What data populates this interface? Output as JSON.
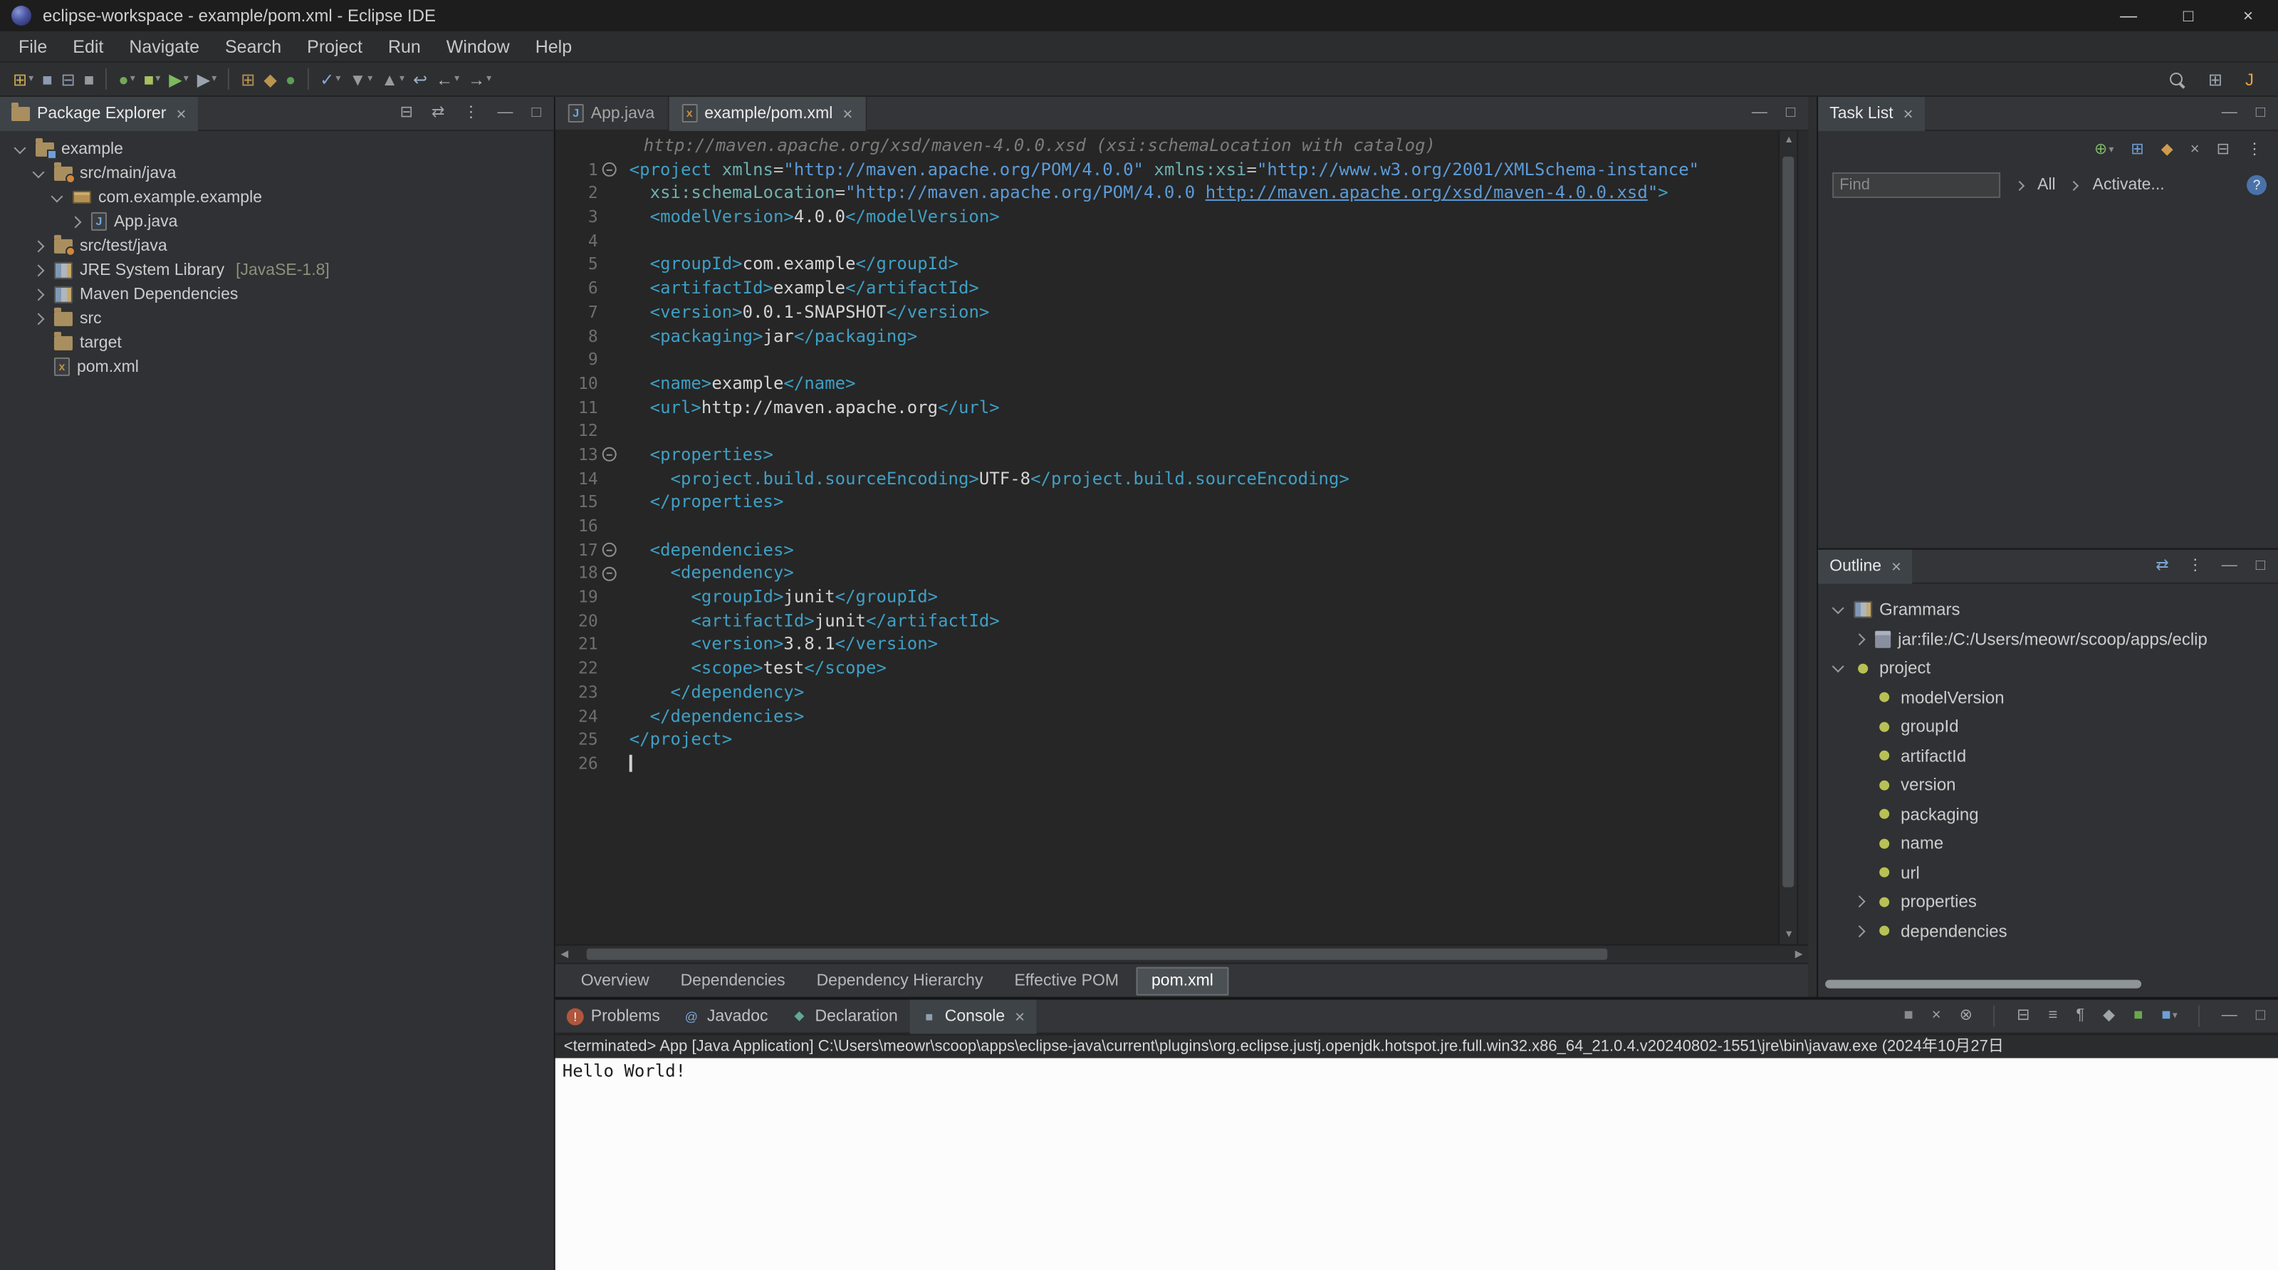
{
  "glyphs": {
    "close": "×",
    "dropdown": "▾",
    "minimize": "—",
    "maximize": "□",
    "up": "▲",
    "down": "▼",
    "left": "◀",
    "right": "▶"
  },
  "window": {
    "title": "eclipse-workspace - example/pom.xml - Eclipse IDE",
    "controls": [
      {
        "name": "minimize",
        "glyph": "—"
      },
      {
        "name": "maximize",
        "glyph": "□"
      },
      {
        "name": "close",
        "glyph": "×"
      }
    ]
  },
  "menu": {
    "items": [
      "File",
      "Edit",
      "Navigate",
      "Search",
      "Project",
      "Run",
      "Window",
      "Help"
    ]
  },
  "toolbar": {
    "items": [
      {
        "name": "new-wizard",
        "glyph": "⊞",
        "color": "#c9a952",
        "drop": true
      },
      {
        "name": "save",
        "glyph": "■",
        "color": "#8c9bb0"
      },
      {
        "name": "save-all",
        "glyph": "⊟",
        "color": "#8c9bb0"
      },
      {
        "name": "print",
        "glyph": "■",
        "color": "#97999c"
      },
      {
        "sep": true
      },
      {
        "name": "debug",
        "glyph": "●",
        "color": "#74a85c",
        "drop": true
      },
      {
        "name": "coverage",
        "glyph": "■",
        "color": "#a8c060",
        "drop": true
      },
      {
        "name": "run",
        "glyph": "▶",
        "color": "#7cba5d",
        "drop": true
      },
      {
        "name": "external-tools",
        "glyph": "▶",
        "color": "#9aa3ad",
        "drop": true
      },
      {
        "sep": true
      },
      {
        "name": "new-java-project",
        "glyph": "⊞",
        "color": "#b89454"
      },
      {
        "name": "new-package",
        "glyph": "◆",
        "color": "#ba9550"
      },
      {
        "name": "new-class",
        "glyph": "●",
        "color": "#5d9e55"
      },
      {
        "sep": true
      },
      {
        "name": "open-task",
        "glyph": "✓",
        "color": "#86a6d8",
        "drop": true
      },
      {
        "name": "next-annotation",
        "glyph": "▼",
        "color": "#9a9a9a",
        "drop": true
      },
      {
        "name": "previous-annotation",
        "glyph": "▲",
        "color": "#9a9a9a",
        "drop": true
      },
      {
        "name": "last-edit-location",
        "glyph": "↩",
        "color": "#9ab0c8"
      },
      {
        "name": "back",
        "glyph": "←",
        "color": "#b8b8b8",
        "drop": true
      },
      {
        "name": "forward",
        "glyph": "→",
        "color": "#b8b8b8",
        "drop": true
      }
    ],
    "right": [
      {
        "name": "search",
        "shape": "magnifier"
      },
      {
        "name": "open-perspective",
        "glyph": "⊞",
        "color": "#9aa3ad"
      },
      {
        "name": "java-perspective",
        "glyph": "J",
        "color": "#e2a33f"
      }
    ]
  },
  "package_explorer": {
    "title": "Package Explorer",
    "header_icons": [
      {
        "name": "collapse-all",
        "glyph": "⊟",
        "color": "#9fa4a8"
      },
      {
        "name": "link-with-editor",
        "glyph": "⇄",
        "color": "#9fa4a8"
      },
      {
        "name": "view-menu",
        "glyph": "⋮",
        "color": "#b8b8b8"
      },
      {
        "name": "minimize",
        "glyph": "—",
        "color": "#9fa4a8"
      },
      {
        "name": "maximize",
        "glyph": "□",
        "color": "#9fa4a8"
      }
    ],
    "tree": [
      {
        "depth": 0,
        "expander": "down",
        "icon": "project",
        "label": "example"
      },
      {
        "depth": 1,
        "expander": "down",
        "icon": "src",
        "label": "src/main/java"
      },
      {
        "depth": 2,
        "expander": "down",
        "icon": "package",
        "label": "com.example.example"
      },
      {
        "depth": 3,
        "expander": "right",
        "icon": "javafile",
        "label": "App.java"
      },
      {
        "depth": 1,
        "expander": "right",
        "icon": "src",
        "label": "src/test/java"
      },
      {
        "depth": 1,
        "expander": "right",
        "icon": "library",
        "label": "JRE System Library",
        "suffix": "[JavaSE-1.8]"
      },
      {
        "depth": 1,
        "expander": "right",
        "icon": "library",
        "label": "Maven Dependencies"
      },
      {
        "depth": 1,
        "expander": "right",
        "icon": "folder",
        "label": "src"
      },
      {
        "depth": 1,
        "expander": "none",
        "icon": "folder",
        "label": "target"
      },
      {
        "depth": 1,
        "expander": "none",
        "icon": "xmlfile",
        "label": "pom.xml"
      }
    ]
  },
  "editor": {
    "tabs": [
      {
        "name": "app-java",
        "label": "App.java",
        "icon": "java",
        "selected": false,
        "closable": false
      },
      {
        "name": "example-pom-xml",
        "label": "example/pom.xml",
        "icon": "xml",
        "selected": true,
        "closable": true
      }
    ],
    "header_icons": [
      {
        "name": "minimize",
        "glyph": "—",
        "color": "#9fa4a8"
      },
      {
        "name": "maximize",
        "glyph": "□",
        "color": "#9fa4a8"
      }
    ],
    "mining": "http://maven.apache.org/xsd/maven-4.0.0.xsd (xsi:schemaLocation with catalog)",
    "lines": [
      {
        "n": 1,
        "fold": true,
        "segs": [
          [
            "t",
            "<project"
          ],
          [
            "x",
            " "
          ],
          [
            "a",
            "xmlns"
          ],
          [
            "o",
            "="
          ],
          [
            "s",
            "\"http://maven.apache.org/POM/4.0.0\""
          ],
          [
            "x",
            " "
          ],
          [
            "a",
            "xmlns:xsi"
          ],
          [
            "o",
            "="
          ],
          [
            "s",
            "\"http://www.w3.org/2001/XMLSchema-instance\""
          ]
        ]
      },
      {
        "n": 2,
        "segs": [
          [
            "x",
            "  "
          ],
          [
            "a",
            "xsi:schemaLocation"
          ],
          [
            "o",
            "="
          ],
          [
            "s",
            "\"http://maven.apache.org/POM/4.0.0 "
          ],
          [
            "l",
            "http://maven.apache.org/xsd/maven-4.0.0.xsd"
          ],
          [
            "s",
            "\""
          ],
          [
            "t",
            ">"
          ]
        ]
      },
      {
        "n": 3,
        "segs": [
          [
            "x",
            "  "
          ],
          [
            "t",
            "<modelVersion>"
          ],
          [
            "x",
            "4.0.0"
          ],
          [
            "t",
            "</modelVersion>"
          ]
        ]
      },
      {
        "n": 4,
        "segs": []
      },
      {
        "n": 5,
        "segs": [
          [
            "x",
            "  "
          ],
          [
            "t",
            "<groupId>"
          ],
          [
            "x",
            "com.example"
          ],
          [
            "t",
            "</groupId>"
          ]
        ]
      },
      {
        "n": 6,
        "segs": [
          [
            "x",
            "  "
          ],
          [
            "t",
            "<artifactId>"
          ],
          [
            "x",
            "example"
          ],
          [
            "t",
            "</artifactId>"
          ]
        ]
      },
      {
        "n": 7,
        "segs": [
          [
            "x",
            "  "
          ],
          [
            "t",
            "<version>"
          ],
          [
            "x",
            "0.0.1-SNAPSHOT"
          ],
          [
            "t",
            "</version>"
          ]
        ]
      },
      {
        "n": 8,
        "segs": [
          [
            "x",
            "  "
          ],
          [
            "t",
            "<packaging>"
          ],
          [
            "x",
            "jar"
          ],
          [
            "t",
            "</packaging>"
          ]
        ]
      },
      {
        "n": 9,
        "segs": []
      },
      {
        "n": 10,
        "segs": [
          [
            "x",
            "  "
          ],
          [
            "t",
            "<name>"
          ],
          [
            "x",
            "example"
          ],
          [
            "t",
            "</name>"
          ]
        ]
      },
      {
        "n": 11,
        "segs": [
          [
            "x",
            "  "
          ],
          [
            "t",
            "<url>"
          ],
          [
            "x",
            "http://maven.apache.org"
          ],
          [
            "t",
            "</url>"
          ]
        ]
      },
      {
        "n": 12,
        "segs": []
      },
      {
        "n": 13,
        "fold": true,
        "segs": [
          [
            "x",
            "  "
          ],
          [
            "t",
            "<properties>"
          ]
        ]
      },
      {
        "n": 14,
        "segs": [
          [
            "x",
            "    "
          ],
          [
            "t",
            "<project.build.sourceEncoding>"
          ],
          [
            "x",
            "UTF-8"
          ],
          [
            "t",
            "</project.build.sourceEncoding>"
          ]
        ]
      },
      {
        "n": 15,
        "segs": [
          [
            "x",
            "  "
          ],
          [
            "t",
            "</properties>"
          ]
        ]
      },
      {
        "n": 16,
        "segs": []
      },
      {
        "n": 17,
        "fold": true,
        "segs": [
          [
            "x",
            "  "
          ],
          [
            "t",
            "<dependencies>"
          ]
        ]
      },
      {
        "n": 18,
        "fold": true,
        "segs": [
          [
            "x",
            "    "
          ],
          [
            "t",
            "<dependency>"
          ]
        ]
      },
      {
        "n": 19,
        "segs": [
          [
            "x",
            "      "
          ],
          [
            "t",
            "<groupId>"
          ],
          [
            "x",
            "junit"
          ],
          [
            "t",
            "</groupId>"
          ]
        ]
      },
      {
        "n": 20,
        "segs": [
          [
            "x",
            "      "
          ],
          [
            "t",
            "<artifactId>"
          ],
          [
            "x",
            "junit"
          ],
          [
            "t",
            "</artifactId>"
          ]
        ]
      },
      {
        "n": 21,
        "segs": [
          [
            "x",
            "      "
          ],
          [
            "t",
            "<version>"
          ],
          [
            "x",
            "3.8.1"
          ],
          [
            "t",
            "</version>"
          ]
        ]
      },
      {
        "n": 22,
        "segs": [
          [
            "x",
            "      "
          ],
          [
            "t",
            "<scope>"
          ],
          [
            "x",
            "test"
          ],
          [
            "t",
            "</scope>"
          ]
        ]
      },
      {
        "n": 23,
        "segs": [
          [
            "x",
            "    "
          ],
          [
            "t",
            "</dependency>"
          ]
        ]
      },
      {
        "n": 24,
        "segs": [
          [
            "x",
            "  "
          ],
          [
            "t",
            "</dependencies>"
          ]
        ]
      },
      {
        "n": 25,
        "segs": [
          [
            "t",
            "</project>"
          ]
        ]
      },
      {
        "n": 26,
        "segs": [],
        "caret": true
      }
    ],
    "bottom_tabs": [
      {
        "label": "Overview"
      },
      {
        "label": "Dependencies"
      },
      {
        "label": "Dependency Hierarchy"
      },
      {
        "label": "Effective POM"
      },
      {
        "label": "pom.xml",
        "selected": true
      }
    ]
  },
  "task_list": {
    "title": "Task List",
    "find_placeholder": "Find",
    "all_label": "All",
    "activate_label": "Activate...",
    "help_glyph": "?",
    "header_icons": [
      {
        "name": "minimize",
        "glyph": "—",
        "color": "#9fa4a8"
      },
      {
        "name": "maximize",
        "glyph": "□",
        "color": "#9fa4a8"
      }
    ],
    "toolbar_icons": [
      {
        "name": "new-task",
        "glyph": "⊕",
        "color": "#7db66a",
        "drop": true
      },
      {
        "name": "categorized",
        "glyph": "⊞",
        "color": "#6f9fd8"
      },
      {
        "name": "scheduled",
        "glyph": "◆",
        "color": "#d09a4e"
      },
      {
        "name": "filter-completed",
        "glyph": "×",
        "color": "#9fa4a8"
      },
      {
        "name": "collapse-all",
        "glyph": "⊟",
        "color": "#9fa4a8"
      },
      {
        "name": "view-menu",
        "glyph": "⋮",
        "color": "#b8b8b8"
      }
    ]
  },
  "outline": {
    "title": "Outline",
    "header_icons": [
      {
        "name": "link-with-editor",
        "glyph": "⇄",
        "color": "#7fa6d0"
      },
      {
        "name": "view-menu",
        "glyph": "⋮",
        "color": "#b8b8b8"
      },
      {
        "name": "minimize",
        "glyph": "—",
        "color": "#9fa4a8"
      },
      {
        "name": "maximize",
        "glyph": "□",
        "color": "#9fa4a8"
      }
    ],
    "tree": [
      {
        "depth": 0,
        "expander": "down",
        "icon": "grammar",
        "label": "Grammars"
      },
      {
        "depth": 1,
        "expander": "right",
        "icon": "jar",
        "label": "jar:file:/C:/Users/meowr/scoop/apps/eclip"
      },
      {
        "depth": 0,
        "expander": "down",
        "icon": "element",
        "label": "project"
      },
      {
        "depth": 1,
        "expander": "none",
        "icon": "element",
        "label": "modelVersion"
      },
      {
        "depth": 1,
        "expander": "none",
        "icon": "element",
        "label": "groupId"
      },
      {
        "depth": 1,
        "expander": "none",
        "icon": "element",
        "label": "artifactId"
      },
      {
        "depth": 1,
        "expander": "none",
        "icon": "element",
        "label": "version"
      },
      {
        "depth": 1,
        "expander": "none",
        "icon": "element",
        "label": "packaging"
      },
      {
        "depth": 1,
        "expander": "none",
        "icon": "element",
        "label": "name"
      },
      {
        "depth": 1,
        "expander": "none",
        "icon": "element",
        "label": "url"
      },
      {
        "depth": 1,
        "expander": "right",
        "icon": "element",
        "label": "properties"
      },
      {
        "depth": 1,
        "expander": "right",
        "icon": "element",
        "label": "dependencies"
      }
    ]
  },
  "console": {
    "tabs": [
      {
        "name": "problems",
        "label": "Problems",
        "glyph": "!",
        "color": "#ffffff",
        "bg": "#b0563c"
      },
      {
        "name": "javadoc",
        "label": "Javadoc",
        "glyph": "@",
        "color": "#7da7d9"
      },
      {
        "name": "declaration",
        "label": "Declaration",
        "glyph": "◆",
        "color": "#62a892"
      },
      {
        "name": "console",
        "label": "Console",
        "glyph": "■",
        "color": "#8ea0b0",
        "selected": true,
        "closable": true
      }
    ],
    "toolbar_icons": [
      {
        "name": "terminate",
        "glyph": "■",
        "color": "#8a8a8a"
      },
      {
        "name": "remove-launch",
        "glyph": "×",
        "color": "#9fa4a8"
      },
      {
        "name": "remove-all-terminated",
        "glyph": "⊗",
        "color": "#9fa4a8"
      },
      {
        "sep": true
      },
      {
        "name": "clear-console",
        "glyph": "⊟",
        "color": "#9fa4a8"
      },
      {
        "name": "scroll-lock",
        "glyph": "≡",
        "color": "#9fa4a8"
      },
      {
        "name": "word-wrap",
        "glyph": "¶",
        "color": "#9fa4a8"
      },
      {
        "name": "pin-console",
        "glyph": "◆",
        "color": "#9fa4a8"
      },
      {
        "name": "display-selected-console",
        "glyph": "■",
        "color": "#6aa84f"
      },
      {
        "name": "open-console",
        "glyph": "■",
        "color": "#6f9fd8",
        "drop": true
      },
      {
        "sep": true
      },
      {
        "name": "minimize",
        "glyph": "—",
        "color": "#9fa4a8"
      },
      {
        "name": "maximize",
        "glyph": "□",
        "color": "#9fa4a8"
      }
    ],
    "header": "<terminated> App [Java Application] C:\\Users\\meowr\\scoop\\apps\\eclipse-java\\current\\plugins\\org.eclipse.justj.openjdk.hotspot.jre.full.win32.x86_64_21.0.4.v20240802-1551\\jre\\bin\\javaw.exe (2024年10月27日",
    "output": "Hello World!"
  },
  "colors": {
    "accent_teal_tag": "#3f9fc4",
    "attribute": "#6fb0b0",
    "string_value": "#5b9bd9",
    "editor_bg": "#262626",
    "chrome_bg": "#2e2f31",
    "console_bg": "#fcfcfc"
  }
}
